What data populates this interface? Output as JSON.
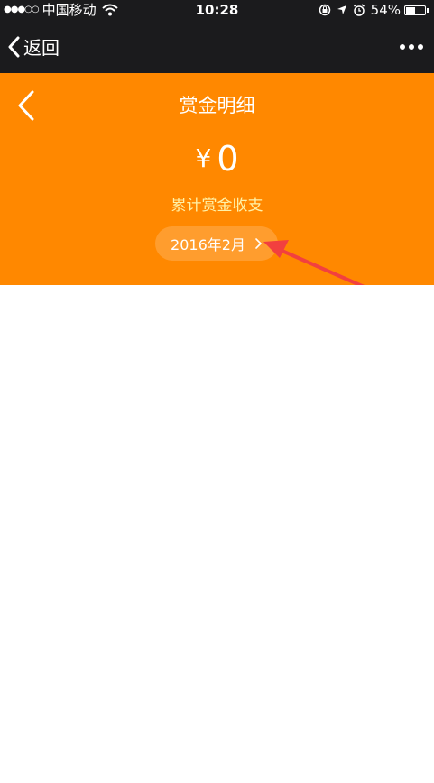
{
  "status_bar": {
    "signal": "●●●○○",
    "carrier": "中国移动",
    "time": "10:28",
    "battery": "54%",
    "battery_level": 0.54
  },
  "nav": {
    "back_label": "返回"
  },
  "header": {
    "title": "赏金明细",
    "currency_symbol": "¥",
    "amount": "0",
    "amount_label": "累计赏金收支",
    "month": "2016年2月"
  },
  "colors": {
    "header_bg": "#ff8800",
    "nav_bg": "#1b1b1d",
    "label": "#fff2a8",
    "annotation_arrow": "#f2403f"
  }
}
